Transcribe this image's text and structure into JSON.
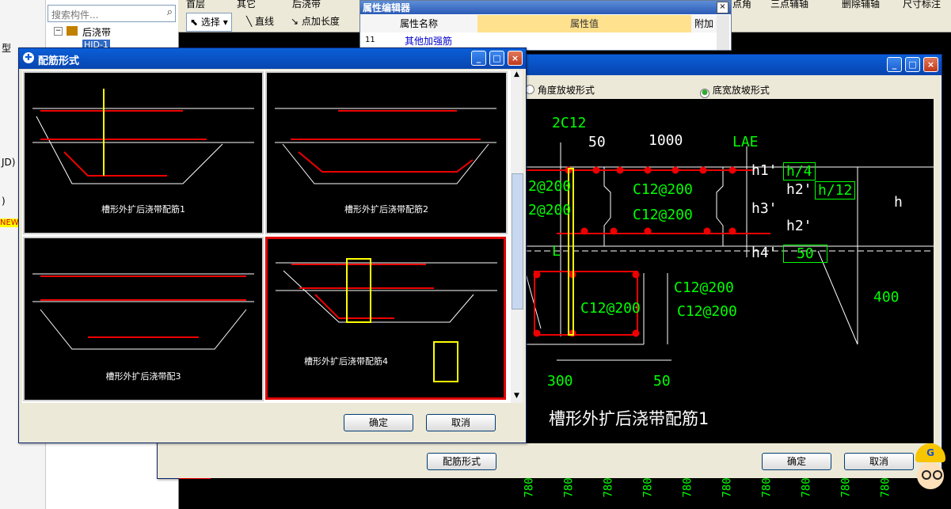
{
  "topbar": {
    "select_label": "选择",
    "line_label": "直线",
    "addlen_label": "点加长度",
    "floor_label": "首层",
    "other_label": "其它",
    "post_label": "后浇带",
    "point_label": "点角",
    "threepoint_label": "三点辅轴",
    "delete_aux_label": "删除辅轴",
    "dim_label": "尺寸标注"
  },
  "left": {
    "search_placeholder": "搜索构件...",
    "tree_root": "后浇带",
    "tree_child": "HJD-1",
    "strip_items": [
      "型",
      "JD)",
      ")",
      "NEW"
    ]
  },
  "prop_editor": {
    "title": "属性编辑器",
    "col_name": "属性名称",
    "col_value": "属性值",
    "col_extra": "附加",
    "row_no": "11",
    "row_name": "其他加强筋"
  },
  "big_dialog": {
    "radio_angle": "角度放坡形式",
    "radio_bottom": "底宽放坡形式",
    "btn_rebar_form": "配筋形式",
    "btn_ok": "确定",
    "btn_cancel": "取消",
    "caption": "槽形外扩后浇带配筋1",
    "labels": {
      "c2c12": "2C12",
      "d50a": "50",
      "d1000": "1000",
      "lae": "LAE",
      "h1": "h1'",
      "h1v": "h/4",
      "h2p": "h2'",
      "h2v": "h/12",
      "h": "h",
      "h3": "h3'",
      "h2b": "h2'",
      "h4": "h4'",
      "h4v": "50",
      "r200a": "2@200",
      "r200b": "2@200",
      "c12a": "C12@200",
      "c12b": "C12@200",
      "l": "L",
      "c12c": "C12@200",
      "c12d": "C12@200",
      "c12e": "C12@200",
      "d400": "400",
      "d300": "300",
      "d50b": "50"
    }
  },
  "small_dialog": {
    "title": "配筋形式",
    "btn_ok": "确定",
    "btn_cancel": "取消",
    "thumbs": [
      {
        "caption": "槽形外扩后浇带配筋1"
      },
      {
        "caption": "槽形外扩后浇带配筋2"
      },
      {
        "caption": "槽形外扩后浇带配3"
      },
      {
        "caption": "槽形外扩后浇带配筋4"
      }
    ]
  },
  "bottom_axis": [
    "780",
    "780",
    "780",
    "780",
    "780",
    "780",
    "780",
    "780",
    "780",
    "780"
  ]
}
